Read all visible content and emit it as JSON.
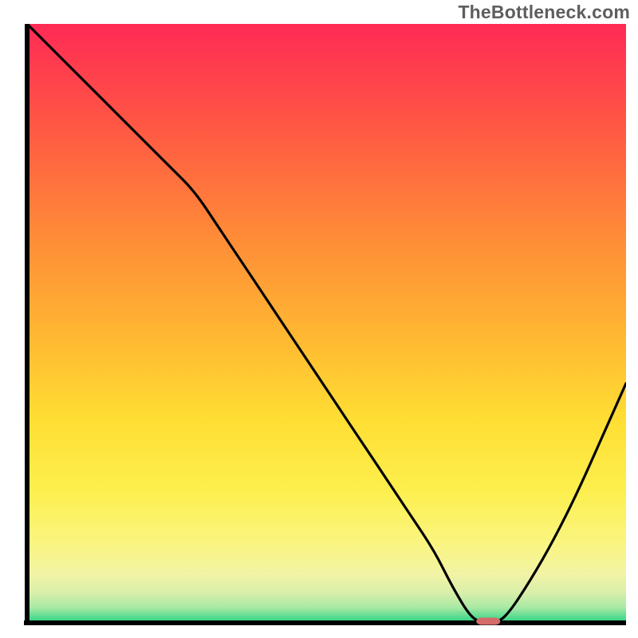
{
  "watermark": "TheBottleneck.com",
  "chart_data": {
    "type": "line",
    "title": "",
    "xlabel": "",
    "ylabel": "",
    "xlim": [
      0,
      100
    ],
    "ylim": [
      0,
      100
    ],
    "x": [
      0,
      4,
      8,
      12,
      16,
      20,
      24,
      28,
      32,
      36,
      40,
      44,
      48,
      52,
      56,
      60,
      64,
      68,
      71,
      74,
      76,
      78,
      80,
      84,
      88,
      92,
      96,
      100
    ],
    "values": [
      100,
      96,
      92,
      88,
      84,
      80,
      76,
      72,
      66,
      60,
      54,
      48,
      42,
      36,
      30,
      24,
      18,
      12,
      6,
      1,
      0,
      0,
      1,
      7,
      14,
      22,
      31,
      40
    ],
    "minimum_marker": {
      "x": 77,
      "y": 0,
      "width_pct": 4,
      "height_pct": 1.2,
      "color": "#d46a6a"
    },
    "background_gradient": {
      "top_color": "#ff2a55",
      "middle_colors": [
        "#ff6a3e",
        "#ffa733",
        "#ffd733",
        "#fdee4d",
        "#faf57a",
        "#f3f4a6",
        "#e6f3b0",
        "#c7efad",
        "#87e4a0"
      ],
      "bottom_color": "#27d282"
    }
  }
}
